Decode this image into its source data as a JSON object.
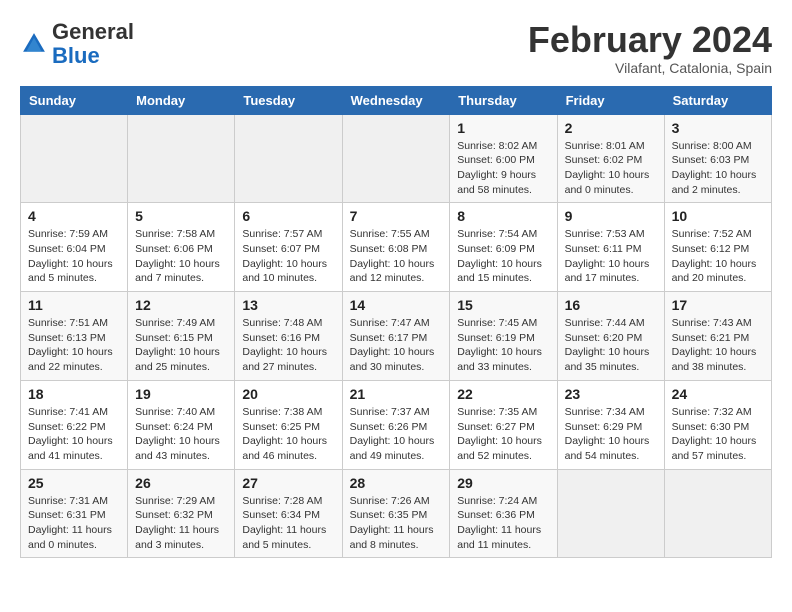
{
  "header": {
    "logo_general": "General",
    "logo_blue": "Blue",
    "month_title": "February 2024",
    "subtitle": "Vilafant, Catalonia, Spain"
  },
  "calendar": {
    "days_of_week": [
      "Sunday",
      "Monday",
      "Tuesday",
      "Wednesday",
      "Thursday",
      "Friday",
      "Saturday"
    ],
    "weeks": [
      [
        {
          "day": "",
          "info": ""
        },
        {
          "day": "",
          "info": ""
        },
        {
          "day": "",
          "info": ""
        },
        {
          "day": "",
          "info": ""
        },
        {
          "day": "1",
          "info": "Sunrise: 8:02 AM\nSunset: 6:00 PM\nDaylight: 9 hours and 58 minutes."
        },
        {
          "day": "2",
          "info": "Sunrise: 8:01 AM\nSunset: 6:02 PM\nDaylight: 10 hours and 0 minutes."
        },
        {
          "day": "3",
          "info": "Sunrise: 8:00 AM\nSunset: 6:03 PM\nDaylight: 10 hours and 2 minutes."
        }
      ],
      [
        {
          "day": "4",
          "info": "Sunrise: 7:59 AM\nSunset: 6:04 PM\nDaylight: 10 hours and 5 minutes."
        },
        {
          "day": "5",
          "info": "Sunrise: 7:58 AM\nSunset: 6:06 PM\nDaylight: 10 hours and 7 minutes."
        },
        {
          "day": "6",
          "info": "Sunrise: 7:57 AM\nSunset: 6:07 PM\nDaylight: 10 hours and 10 minutes."
        },
        {
          "day": "7",
          "info": "Sunrise: 7:55 AM\nSunset: 6:08 PM\nDaylight: 10 hours and 12 minutes."
        },
        {
          "day": "8",
          "info": "Sunrise: 7:54 AM\nSunset: 6:09 PM\nDaylight: 10 hours and 15 minutes."
        },
        {
          "day": "9",
          "info": "Sunrise: 7:53 AM\nSunset: 6:11 PM\nDaylight: 10 hours and 17 minutes."
        },
        {
          "day": "10",
          "info": "Sunrise: 7:52 AM\nSunset: 6:12 PM\nDaylight: 10 hours and 20 minutes."
        }
      ],
      [
        {
          "day": "11",
          "info": "Sunrise: 7:51 AM\nSunset: 6:13 PM\nDaylight: 10 hours and 22 minutes."
        },
        {
          "day": "12",
          "info": "Sunrise: 7:49 AM\nSunset: 6:15 PM\nDaylight: 10 hours and 25 minutes."
        },
        {
          "day": "13",
          "info": "Sunrise: 7:48 AM\nSunset: 6:16 PM\nDaylight: 10 hours and 27 minutes."
        },
        {
          "day": "14",
          "info": "Sunrise: 7:47 AM\nSunset: 6:17 PM\nDaylight: 10 hours and 30 minutes."
        },
        {
          "day": "15",
          "info": "Sunrise: 7:45 AM\nSunset: 6:19 PM\nDaylight: 10 hours and 33 minutes."
        },
        {
          "day": "16",
          "info": "Sunrise: 7:44 AM\nSunset: 6:20 PM\nDaylight: 10 hours and 35 minutes."
        },
        {
          "day": "17",
          "info": "Sunrise: 7:43 AM\nSunset: 6:21 PM\nDaylight: 10 hours and 38 minutes."
        }
      ],
      [
        {
          "day": "18",
          "info": "Sunrise: 7:41 AM\nSunset: 6:22 PM\nDaylight: 10 hours and 41 minutes."
        },
        {
          "day": "19",
          "info": "Sunrise: 7:40 AM\nSunset: 6:24 PM\nDaylight: 10 hours and 43 minutes."
        },
        {
          "day": "20",
          "info": "Sunrise: 7:38 AM\nSunset: 6:25 PM\nDaylight: 10 hours and 46 minutes."
        },
        {
          "day": "21",
          "info": "Sunrise: 7:37 AM\nSunset: 6:26 PM\nDaylight: 10 hours and 49 minutes."
        },
        {
          "day": "22",
          "info": "Sunrise: 7:35 AM\nSunset: 6:27 PM\nDaylight: 10 hours and 52 minutes."
        },
        {
          "day": "23",
          "info": "Sunrise: 7:34 AM\nSunset: 6:29 PM\nDaylight: 10 hours and 54 minutes."
        },
        {
          "day": "24",
          "info": "Sunrise: 7:32 AM\nSunset: 6:30 PM\nDaylight: 10 hours and 57 minutes."
        }
      ],
      [
        {
          "day": "25",
          "info": "Sunrise: 7:31 AM\nSunset: 6:31 PM\nDaylight: 11 hours and 0 minutes."
        },
        {
          "day": "26",
          "info": "Sunrise: 7:29 AM\nSunset: 6:32 PM\nDaylight: 11 hours and 3 minutes."
        },
        {
          "day": "27",
          "info": "Sunrise: 7:28 AM\nSunset: 6:34 PM\nDaylight: 11 hours and 5 minutes."
        },
        {
          "day": "28",
          "info": "Sunrise: 7:26 AM\nSunset: 6:35 PM\nDaylight: 11 hours and 8 minutes."
        },
        {
          "day": "29",
          "info": "Sunrise: 7:24 AM\nSunset: 6:36 PM\nDaylight: 11 hours and 11 minutes."
        },
        {
          "day": "",
          "info": ""
        },
        {
          "day": "",
          "info": ""
        }
      ]
    ]
  }
}
